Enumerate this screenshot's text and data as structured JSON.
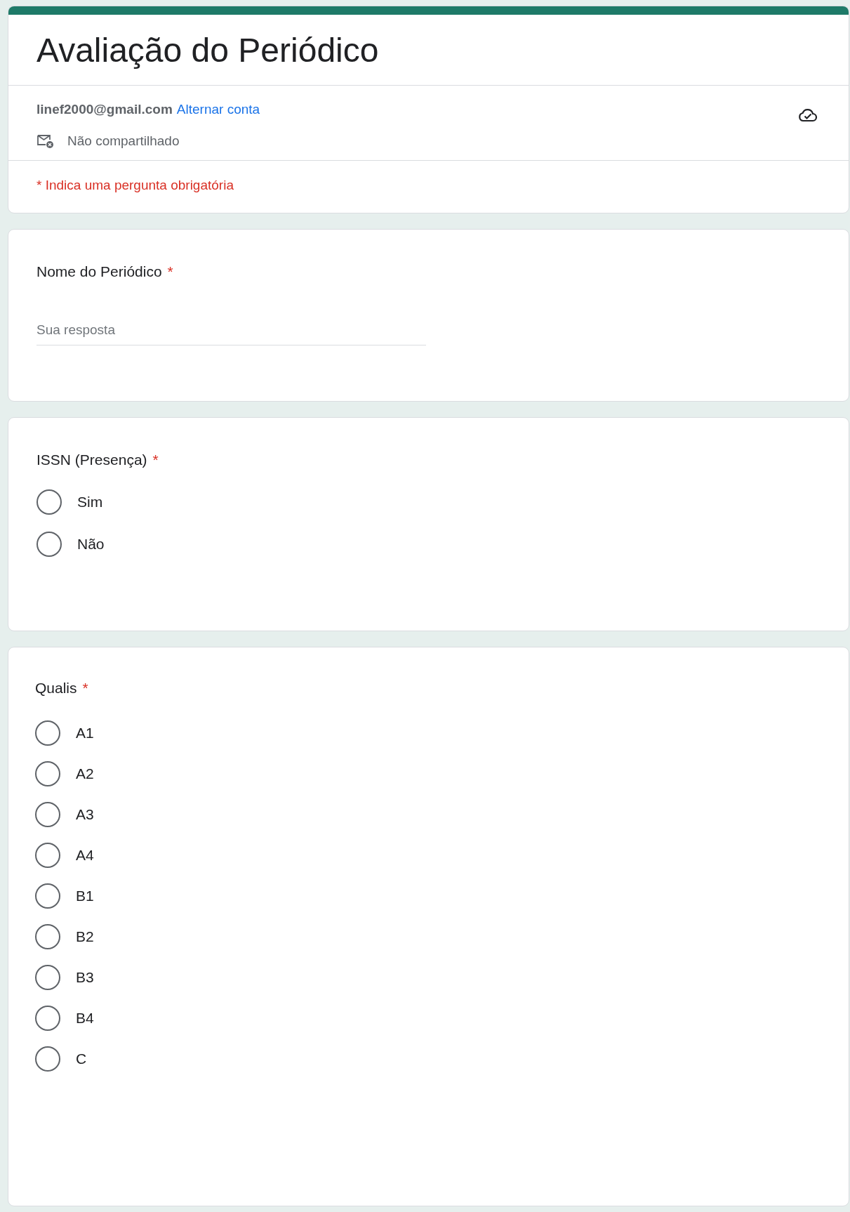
{
  "form": {
    "title": "Avaliação do Periódico",
    "account": {
      "email": "linef2000@gmail.com",
      "switch_link": "Alternar conta",
      "sharing": "Não compartilhado"
    },
    "required_notice": "* Indica uma pergunta obrigatória"
  },
  "questions": [
    {
      "kind": "short_answer",
      "title": "Nome do Periódico",
      "mark": "*",
      "placeholder": "Sua resposta"
    },
    {
      "kind": "radio",
      "title": "ISSN (Presença)",
      "mark": "*",
      "options": [
        {
          "label": "Sim",
          "selected": false
        },
        {
          "label": "Não",
          "selected": false
        }
      ]
    },
    {
      "kind": "radio",
      "title": "Qualis",
      "mark": "*",
      "options": [
        {
          "label": "A1",
          "selected": false
        },
        {
          "label": "A2",
          "selected": false
        },
        {
          "label": "A3",
          "selected": false
        },
        {
          "label": "A4",
          "selected": false
        },
        {
          "label": "B1",
          "selected": false
        },
        {
          "label": "B2",
          "selected": false
        },
        {
          "label": "B3",
          "selected": false
        },
        {
          "label": "B4",
          "selected": false
        },
        {
          "label": "C",
          "selected": false
        }
      ]
    }
  ]
}
